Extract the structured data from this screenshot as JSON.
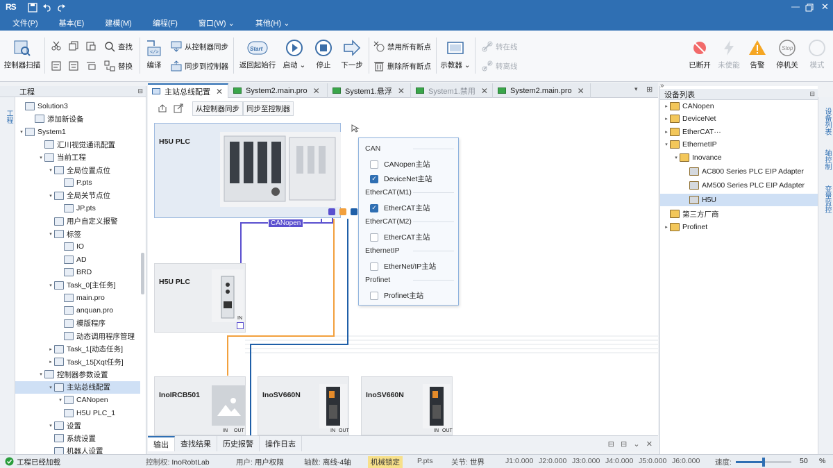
{
  "app": {
    "logo": "RS"
  },
  "menu": [
    "文件(P)",
    "基本(E)",
    "建模(M)",
    "编程(F)",
    "窗口(W)",
    "其他(H)"
  ],
  "ribbon": {
    "scan": "控制器扫描",
    "find": "查找",
    "replace": "替换",
    "compile": "编译",
    "sync_from": "从控制器同步",
    "sync_to": "同步到控制器",
    "return_start": "返回起始行",
    "start_icon": "Start",
    "start": "启动",
    "stop": "停止",
    "next": "下一步",
    "disable_bp": "禁用所有断点",
    "delete_bp": "删除所有断点",
    "teach": "示教器",
    "online": "转在线",
    "offline": "转离线",
    "disconnected": "已断开",
    "disabled": "未使能",
    "alarm": "告警",
    "stop_icon": "Stop",
    "halt": "停机关",
    "mode": "模式"
  },
  "project_panel": {
    "title": "工程",
    "vtab": "工程",
    "tree": [
      {
        "label": "Solution3",
        "lvl": 0,
        "arrow": "",
        "icon": "solution-icon"
      },
      {
        "label": "添加新设备",
        "lvl": 1,
        "arrow": "",
        "icon": "add-device-icon"
      },
      {
        "label": "System1",
        "lvl": 0,
        "arrow": "▾",
        "icon": "system-icon"
      },
      {
        "label": "汇川视觉通讯配置",
        "lvl": 2,
        "arrow": "",
        "icon": "camera-icon"
      },
      {
        "label": "当前工程",
        "lvl": 2,
        "arrow": "▾",
        "icon": "project-icon"
      },
      {
        "label": "全局位置点位",
        "lvl": 3,
        "arrow": "▾",
        "icon": "point-icon"
      },
      {
        "label": "P.pts",
        "lvl": 4,
        "arrow": "",
        "icon": "file-icon"
      },
      {
        "label": "全局关节点位",
        "lvl": 3,
        "arrow": "▾",
        "icon": "point-icon"
      },
      {
        "label": "JP.pts",
        "lvl": 4,
        "arrow": "",
        "icon": "file-icon"
      },
      {
        "label": "用户自定义报警",
        "lvl": 3,
        "arrow": "",
        "icon": "alarm-icon"
      },
      {
        "label": "标签",
        "lvl": 3,
        "arrow": "▾",
        "icon": "tag-icon"
      },
      {
        "label": "IO",
        "lvl": 4,
        "arrow": "",
        "icon": "io-icon"
      },
      {
        "label": "AD",
        "lvl": 4,
        "arrow": "",
        "icon": "ad-icon"
      },
      {
        "label": "BRD",
        "lvl": 4,
        "arrow": "",
        "icon": "brd-icon"
      },
      {
        "label": "Task_0[主任务]",
        "lvl": 3,
        "arrow": "▾",
        "icon": "task-icon"
      },
      {
        "label": "main.pro",
        "lvl": 4,
        "arrow": "",
        "icon": "file-icon"
      },
      {
        "label": "anquan.pro",
        "lvl": 4,
        "arrow": "",
        "icon": "file-icon"
      },
      {
        "label": "模版程序",
        "lvl": 4,
        "arrow": "",
        "icon": "file-icon"
      },
      {
        "label": "动态调用程序管理",
        "lvl": 4,
        "arrow": "",
        "icon": "manage-icon"
      },
      {
        "label": "Task_1[动态任务]",
        "lvl": 3,
        "arrow": "▸",
        "icon": "task-icon"
      },
      {
        "label": "Task_15[Xqt任务]",
        "lvl": 3,
        "arrow": "▸",
        "icon": "task-icon"
      },
      {
        "label": "控制器参数设置",
        "lvl": 2,
        "arrow": "▾",
        "icon": "controller-icon"
      },
      {
        "label": "主站总线配置",
        "lvl": 3,
        "arrow": "▾",
        "icon": "bus-icon",
        "selected": true
      },
      {
        "label": "CANopen",
        "lvl": 4,
        "arrow": "▾",
        "icon": "canopen-icon"
      },
      {
        "label": "H5U  PLC_1",
        "lvl": 4,
        "arrow": "",
        "icon": "plc-icon"
      },
      {
        "label": "设置",
        "lvl": 3,
        "arrow": "▾",
        "icon": "settings-icon"
      },
      {
        "label": "系统设置",
        "lvl": 3,
        "arrow": "",
        "icon": "system-settings-icon"
      },
      {
        "label": "机器人设置",
        "lvl": 3,
        "arrow": "",
        "icon": "robot-icon"
      }
    ]
  },
  "tabs": [
    {
      "label": "主站总线配置",
      "active": true
    },
    {
      "label": "System2.main.pro",
      "active": false
    },
    {
      "label": "System1.悬浮",
      "active": false
    },
    {
      "label": "System1.禁用",
      "active": false,
      "dim": true
    },
    {
      "label": "System2.main.pro",
      "active": false
    }
  ],
  "canvas": {
    "sync_from": "从控制器同步",
    "sync_to": "同步至控制器",
    "plc_main": "H5U PLC",
    "plc_second": "H5U PLC",
    "canopen_tag": "CANopen",
    "in_label": "IN",
    "out_label": "OUT",
    "dev1": "InoIRCB501",
    "dev2": "InoSV660N",
    "dev3": "InoSV660N",
    "colors": {
      "canopen": "#5a4fcf",
      "ethercat1": "#f2a03d",
      "ethercat2": "#1f5fa8"
    }
  },
  "popup": {
    "groups": [
      {
        "title": "CAN",
        "items": [
          {
            "label": "CANopen主站",
            "checked": false
          },
          {
            "label": "DeviceNet主站",
            "checked": true
          }
        ]
      },
      {
        "title": "EtherCAT(M1)",
        "items": [
          {
            "label": "EtherCAT主站",
            "checked": true
          }
        ]
      },
      {
        "title": "EtherCAT(M2)",
        "items": [
          {
            "label": "EtherCAT主站",
            "checked": false
          }
        ]
      },
      {
        "title": "EthernetIP",
        "items": [
          {
            "label": "EtherNet/IP主站",
            "checked": false
          }
        ]
      },
      {
        "title": "Profinet",
        "items": [
          {
            "label": "Profinet主站",
            "checked": false
          }
        ]
      }
    ]
  },
  "bottom_tabs": [
    "输出",
    "查找结果",
    "历史报警",
    "操作日志"
  ],
  "device_panel": {
    "title": "设备列表",
    "vtabs": [
      "设备列表",
      "轴控制",
      "变量监控"
    ],
    "tree": [
      {
        "label": "CANopen",
        "lvl": 0,
        "arrow": "▸",
        "icon": "can-icon"
      },
      {
        "label": "DeviceNet",
        "lvl": 0,
        "arrow": "▸",
        "icon": "can-icon"
      },
      {
        "label": "EtherCAT···",
        "lvl": 0,
        "arrow": "▸",
        "icon": "ethercat-icon"
      },
      {
        "label": "EthernetIP",
        "lvl": 0,
        "arrow": "▾",
        "icon": "ethernetip-icon"
      },
      {
        "label": "Inovance",
        "lvl": 1,
        "arrow": "▾",
        "icon": "folder-icon"
      },
      {
        "label": "AC800 Series PLC EIP Adapter",
        "lvl": 2,
        "arrow": "",
        "icon": "device-icon"
      },
      {
        "label": "AM500 Series PLC EIP Adapter",
        "lvl": 2,
        "arrow": "",
        "icon": "device-icon"
      },
      {
        "label": "H5U",
        "lvl": 2,
        "arrow": "",
        "icon": "device-icon",
        "selected": true
      },
      {
        "label": "第三方厂商",
        "lvl": 0,
        "arrow": "",
        "icon": "folder-icon"
      },
      {
        "label": "Profinet",
        "lvl": 0,
        "arrow": "▸",
        "icon": "profinet-icon"
      }
    ]
  },
  "status": {
    "loaded": "工程已经加载",
    "control": "控制权:",
    "control_v": "InoRobtLab",
    "user": "用户:",
    "user_v": "用户权限",
    "axes": "轴数:",
    "axes_v": "离线-4轴",
    "lock": "机械锁定",
    "pts": "P.pts",
    "joint": "关节:",
    "joint_v": "世界",
    "j1": "J1:0.000",
    "j2": "J2:0.000",
    "j3": "J3:0.000",
    "j4": "J4:0.000",
    "j5": "J5:0.000",
    "j6": "J6:0.000",
    "speed": "速度:",
    "speed_v": "50",
    "speed_unit": "%",
    "speed_fraction": 0.5
  }
}
